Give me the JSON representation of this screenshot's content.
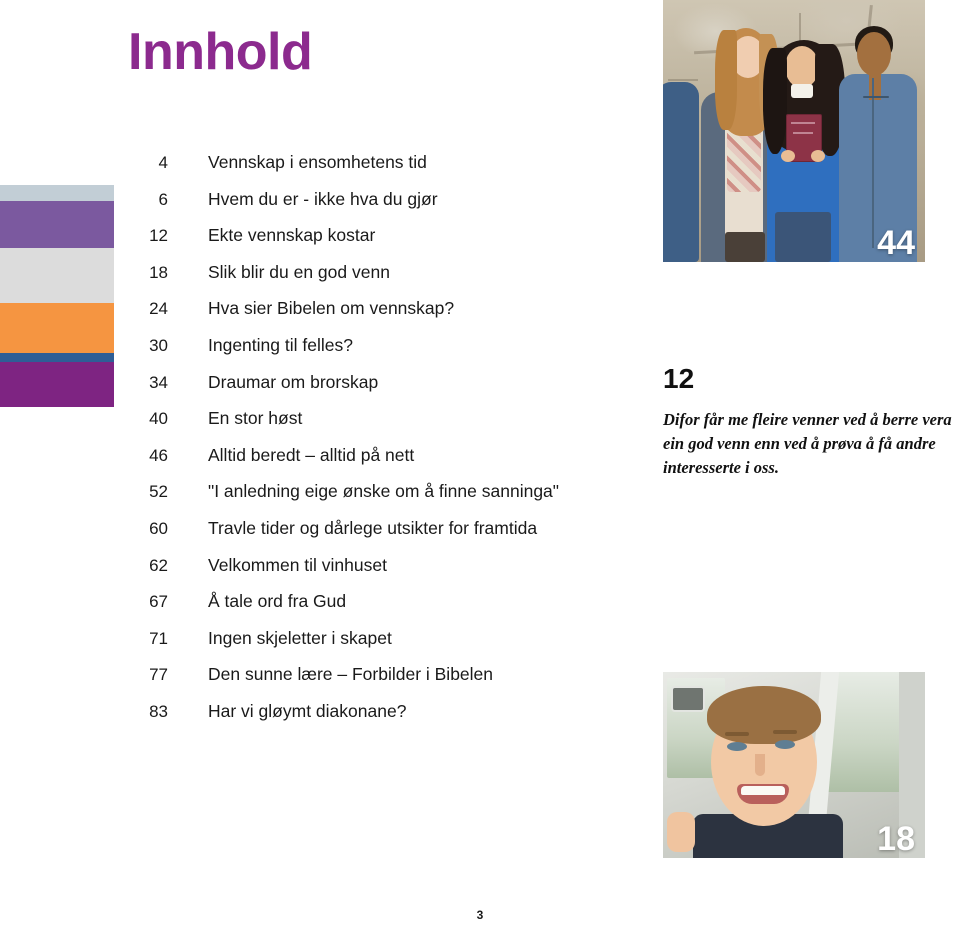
{
  "page": {
    "title": "Innhold",
    "footer_page_number": "3"
  },
  "color_bars": [
    {
      "name": "light-blue",
      "color": "#c2ced6"
    },
    {
      "name": "violet",
      "color": "#7b599f"
    },
    {
      "name": "light-gray",
      "color": "#dcdcdc"
    },
    {
      "name": "orange",
      "color": "#f59541"
    },
    {
      "name": "steel-blue",
      "color": "#2e5e96"
    },
    {
      "name": "purple",
      "color": "#7e2482"
    }
  ],
  "toc": {
    "entries": [
      {
        "page": "4",
        "title": "Vennskap i ensomhetens tid"
      },
      {
        "page": "6",
        "title": "Hvem du er - ikke hva du gjør"
      },
      {
        "page": "12",
        "title": "Ekte vennskap kostar"
      },
      {
        "page": "18",
        "title": "Slik blir du en god venn"
      },
      {
        "page": "24",
        "title": "Hva sier Bibelen om vennskap?"
      },
      {
        "page": "30",
        "title": "Ingenting til felles?"
      },
      {
        "page": "34",
        "title": "Draumar om brorskap"
      },
      {
        "page": "40",
        "title": "En stor høst"
      },
      {
        "page": "46",
        "title": "Alltid beredt – alltid på nett"
      },
      {
        "page": "52",
        "title": "\"I anledning eige ønske om å finne sanninga\""
      },
      {
        "page": "60",
        "title": "Travle tider og dårlege utsikter for framtida"
      },
      {
        "page": "62",
        "title": "Velkommen til vinhuset"
      },
      {
        "page": "67",
        "title": "Å tale ord fra Gud"
      },
      {
        "page": "71",
        "title": "Ingen skjeletter i skapet"
      },
      {
        "page": "77",
        "title": "Den sunne lære – Forbilder i Bibelen"
      },
      {
        "page": "83",
        "title": "Har vi gløymt diakonane?"
      }
    ]
  },
  "photos": {
    "top": {
      "badge": "44",
      "alt": "three young people standing by a weathered wall holding a book"
    },
    "bottom": {
      "badge": "18",
      "alt": "smiling young man seated inside a car"
    }
  },
  "feature": {
    "number": "12",
    "caption": "Difor får me fleire venner ved å berre vera ein god venn enn ved å prøva å få andre interesserte i oss."
  }
}
